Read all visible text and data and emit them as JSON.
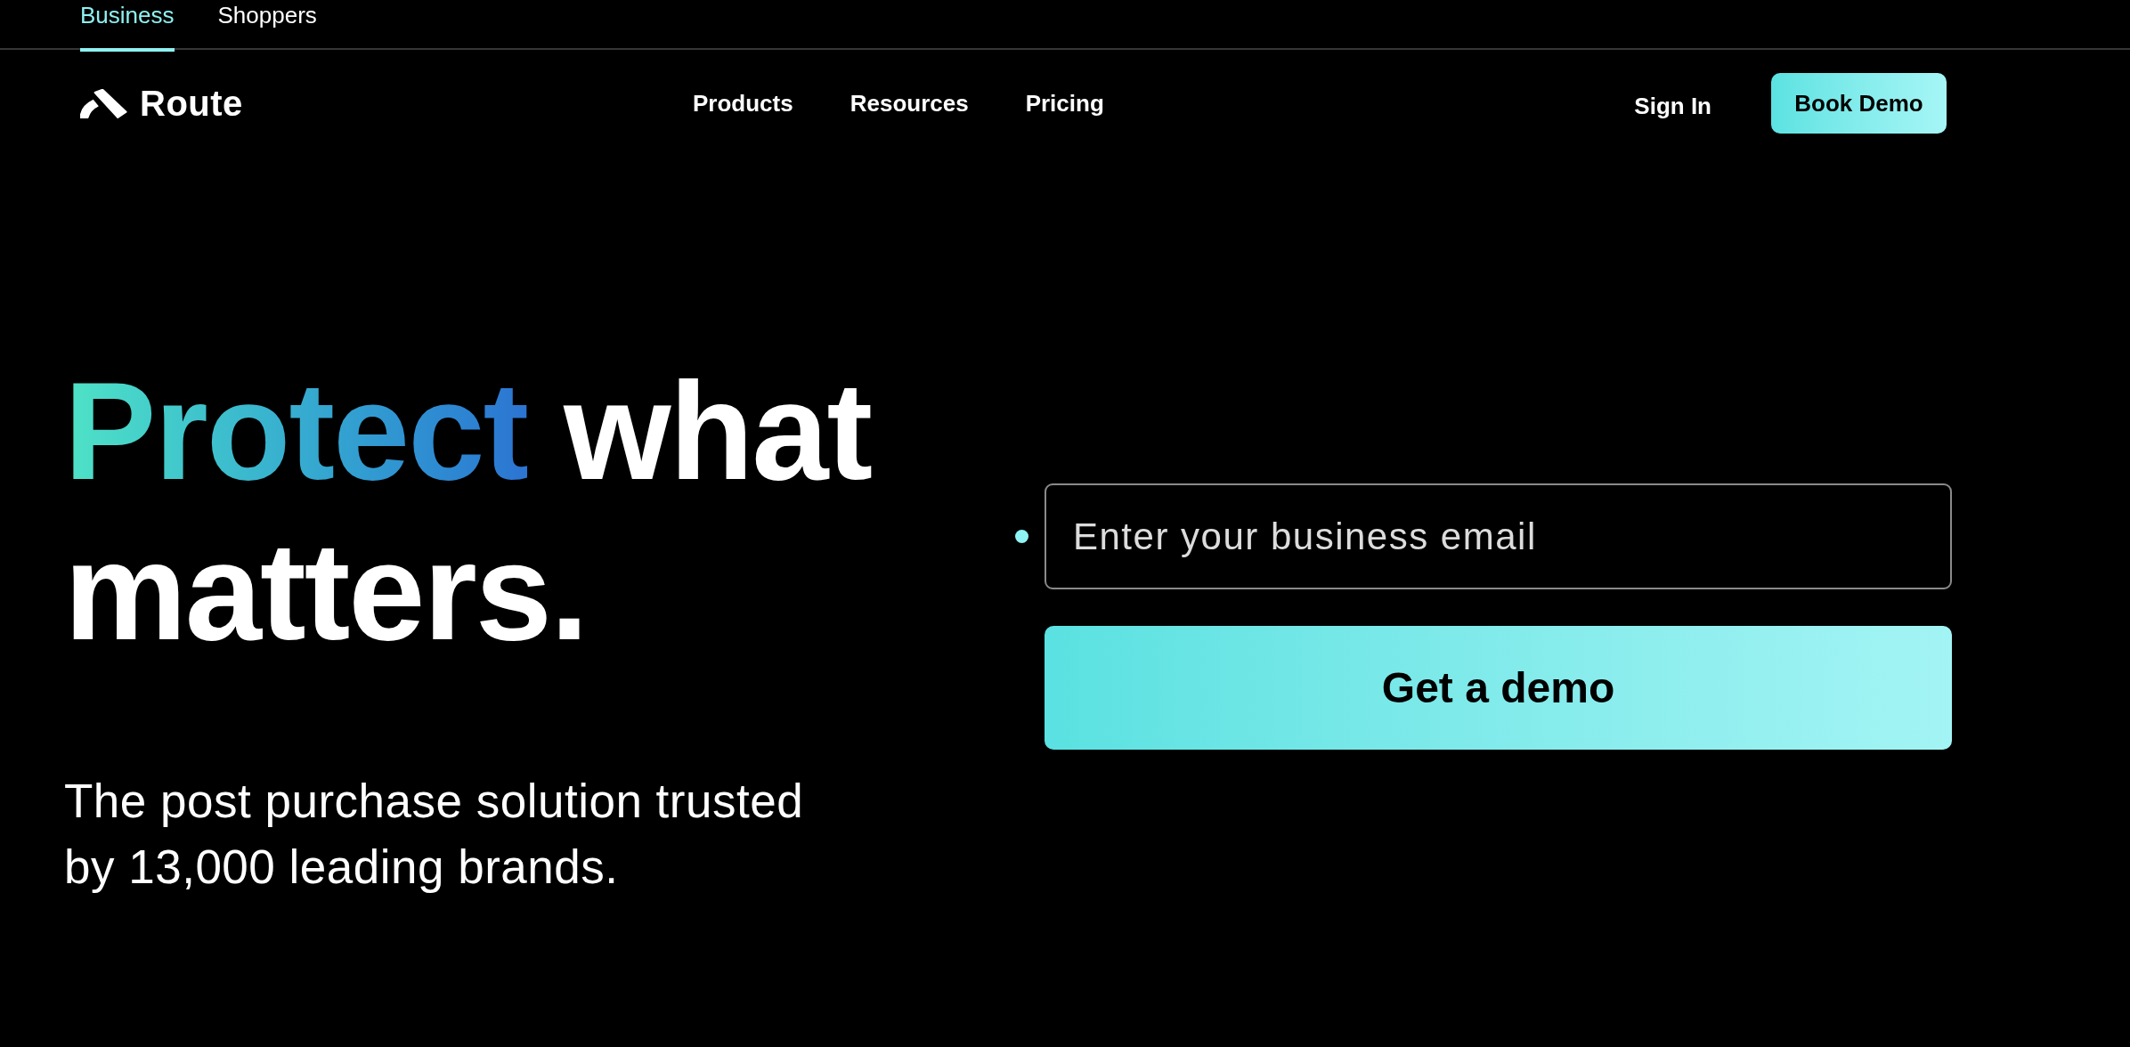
{
  "audience_tabs": [
    {
      "label": "Business",
      "selected": true
    },
    {
      "label": "Shoppers",
      "selected": false
    }
  ],
  "header": {
    "logo_text": "Route",
    "nav": [
      "Products",
      "Resources",
      "Pricing"
    ],
    "sign_in": "Sign In",
    "cta": "Book Demo"
  },
  "hero": {
    "headline": {
      "highlight": "Protect",
      "rest": "what matters."
    },
    "subtitle": "The post purchase solution trusted by 13,000 leading brands."
  },
  "demo_form": {
    "email_field": {
      "placeholder": "Enter your business email"
    },
    "submit": "Get a demo"
  }
}
